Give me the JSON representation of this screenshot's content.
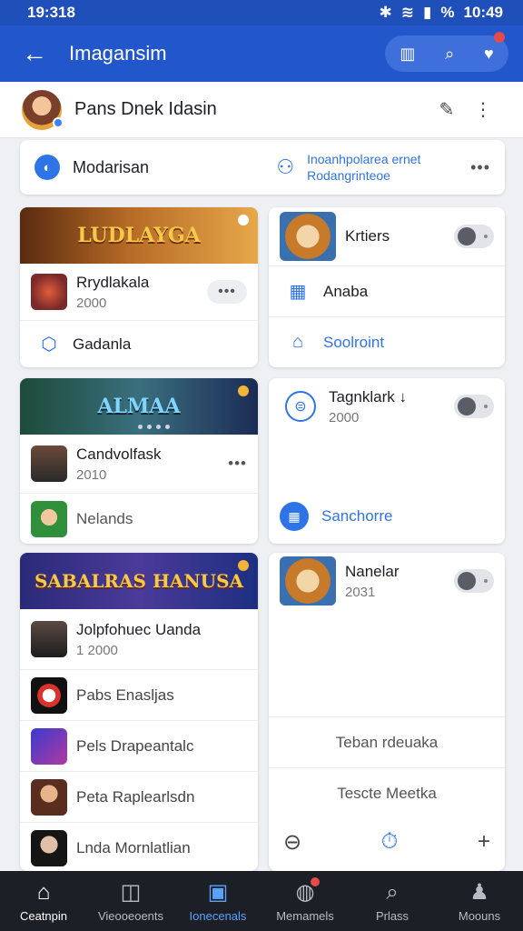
{
  "status": {
    "time": "19:318",
    "right_time": "10:49",
    "battery": "%",
    "icons": [
      "bluetooth-icon",
      "wifi-icon",
      "signal-icon"
    ]
  },
  "appbar": {
    "title": "Imagansim",
    "back_icon": "arrow-left-icon",
    "actions": [
      "grid-icon",
      "search-icon",
      "heart-icon"
    ]
  },
  "profile": {
    "name": "Pans Dnek Idasin",
    "icons": [
      "edit-icon",
      "more-vert-icon"
    ]
  },
  "moderation": {
    "label": "Modarisan",
    "info_line1": "Inoanhpolarea ernet",
    "info_line2": "Rodangrinteoe",
    "more": "•••"
  },
  "left_cards": [
    {
      "banner": "LUDLAYGA",
      "items": [
        {
          "title": "Rrydlakala",
          "subtitle": "2000",
          "more": "•••"
        }
      ],
      "footer": "Gadanla"
    },
    {
      "banner": "ALMAA",
      "items": [
        {
          "title": "Candvolfask",
          "subtitle": "2010",
          "more": "•••"
        }
      ],
      "footer": "Nelands"
    },
    {
      "banner": "SABALRAS HANUSA",
      "items": [
        {
          "title": "Jolpfohuec Uanda",
          "subtitle": "1 2000"
        },
        {
          "title": "Pabs Enasljas"
        },
        {
          "title": "Pels Drapeantalc"
        },
        {
          "title": "Peta Raplearlsdn"
        },
        {
          "title": "Lnda Mornlatlian"
        }
      ]
    }
  ],
  "right_cards": [
    {
      "title": "Krtiers",
      "row2": "Anaba",
      "row3": "Soolroint"
    },
    {
      "title": "Tagnklark ↓",
      "subtitle": "2000",
      "footer": "Sanchorre"
    },
    {
      "title": "Nanelar",
      "subtitle": "2031",
      "row2": "Teban rdeuaka",
      "row3": "Tescte Meetka"
    }
  ],
  "toolbar": {
    "left": "⊖",
    "mid": "⏱",
    "right": "+"
  },
  "nav": [
    {
      "label": "Ceatnpin",
      "icon": "home-icon"
    },
    {
      "label": "Vieooeoents",
      "icon": "camera-icon"
    },
    {
      "label": "Ionecenals",
      "icon": "bag-icon"
    },
    {
      "label": "Memamels",
      "icon": "chat-icon"
    },
    {
      "label": "Prlass",
      "icon": "search-icon"
    },
    {
      "label": "Moouns",
      "icon": "profile-icon"
    }
  ]
}
